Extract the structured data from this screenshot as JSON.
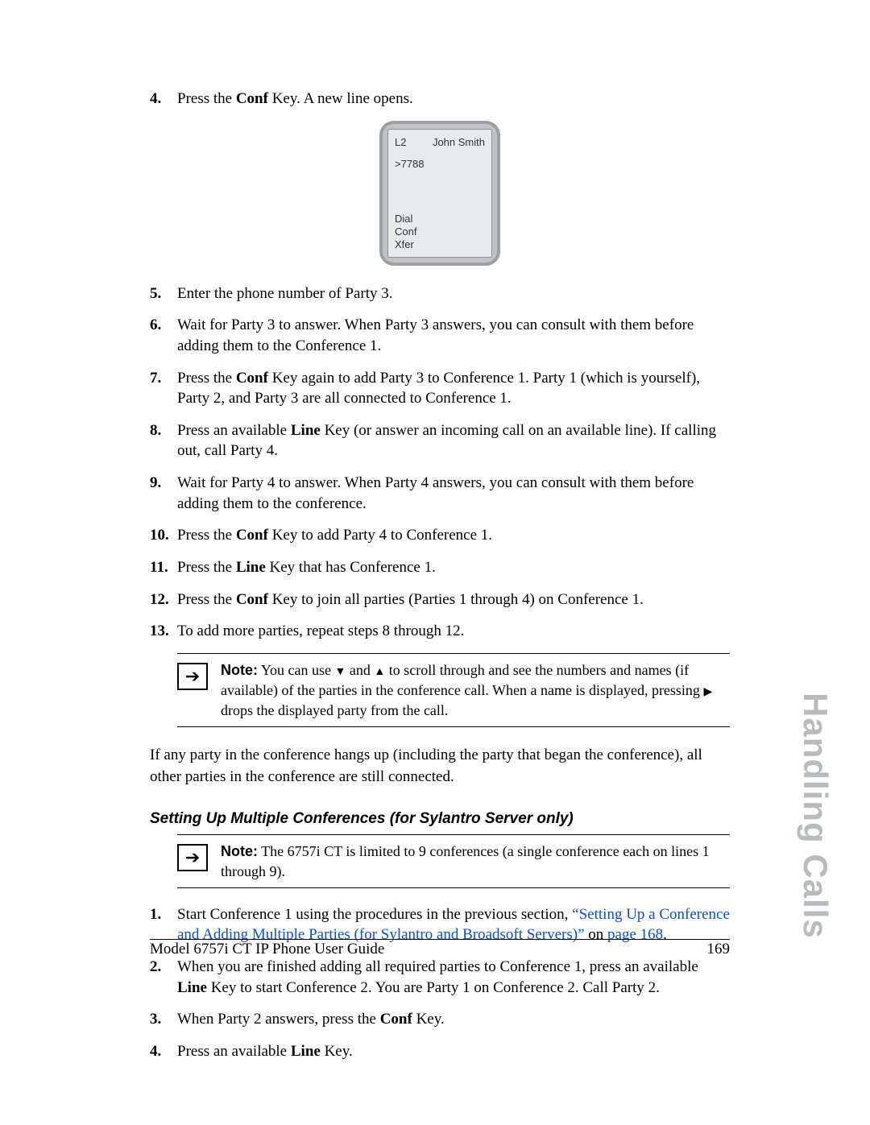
{
  "steps_a": [
    {
      "num": "4.",
      "pre": "Press the ",
      "bold": "Conf",
      "post": " Key. A new line opens."
    }
  ],
  "phone": {
    "line": "L2",
    "name": "John Smith",
    "dialed": ">7788",
    "sk1": "Dial",
    "sk2": "Conf",
    "sk3": "Xfer"
  },
  "steps_b": [
    {
      "num": "5.",
      "html": "Enter the phone number of Party 3."
    },
    {
      "num": "6.",
      "html": "Wait for Party 3 to answer. When Party 3 answers, you can consult with them before adding them to the Conference 1."
    },
    {
      "num": "7.",
      "html": "Press the <b>Conf</b> Key again to add Party 3 to Conference 1. Party 1 (which is yourself), Party 2, and Party 3 are all connected to Conference 1."
    },
    {
      "num": "8.",
      "html": "Press an available <b>Line</b> Key (or answer an incoming call on an available line). If calling out, call Party 4."
    },
    {
      "num": "9.",
      "html": "Wait for Party 4 to answer. When Party 4 answers, you can consult with them before adding them to the conference."
    },
    {
      "num": "10.",
      "html": "Press the <b>Conf</b> Key to add Party 4 to Conference 1."
    },
    {
      "num": "11.",
      "html": "Press the <b>Line</b> Key that has Conference 1."
    },
    {
      "num": "12.",
      "html": "Press the <b>Conf</b> Key to join all parties (Parties 1 through 4) on Conference 1."
    },
    {
      "num": "13.",
      "html": "To add more parties, repeat steps 8 through 12."
    }
  ],
  "note1": {
    "label": "Note:",
    "pre": " You can use ",
    "mid": " and ",
    "post1": " to scroll through and see the numbers and names (if available) of the parties in the conference call. When a name is displayed, pressing ",
    "post2": " drops the displayed party from the call."
  },
  "para_after": "If any party in the conference hangs up (including the party that began the conference), all other parties in the conference are still connected.",
  "subheading": "Setting Up Multiple Conferences (for Sylantro Server only)",
  "note2": {
    "label": "Note:",
    "text": " The 6757i CT is limited to 9 conferences (a single conference each on lines 1 through 9)."
  },
  "steps_c": [
    {
      "num": "1.",
      "html": "Start Conference 1 using the procedures in the previous section, <span class=\"link\">“Setting Up a Conference and Adding Multiple Parties (for Sylantro and Broadsoft Servers)”</span> on <span class=\"link\">page 168</span>."
    },
    {
      "num": "2.",
      "html": "When you are finished adding all required parties to Conference 1, press an available <b>Line</b> Key to start Conference 2. You are Party 1 on Conference 2. Call Party 2."
    },
    {
      "num": "3.",
      "html": "When Party 2 answers, press the <b>Conf</b> Key."
    },
    {
      "num": "4.",
      "html": "Press an available <b>Line</b> Key."
    }
  ],
  "footer": {
    "left": "Model 6757i CT IP Phone User Guide",
    "right": "169"
  },
  "side_tab": "Handling Calls"
}
